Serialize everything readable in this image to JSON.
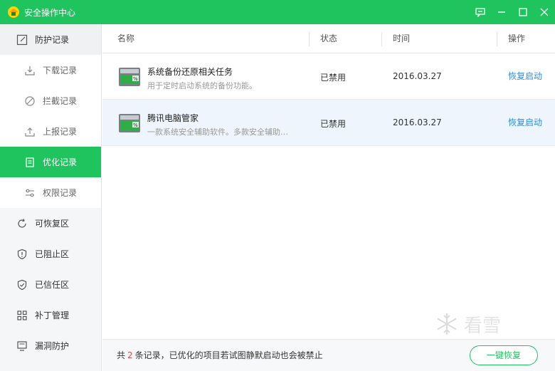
{
  "window": {
    "title": "安全操作中心",
    "accent": "#1fc45f"
  },
  "sidebar": {
    "items": [
      {
        "label": "防护记录",
        "icon": "edit-icon",
        "level": "group"
      },
      {
        "label": "下载记录",
        "icon": "download-icon",
        "level": "sub"
      },
      {
        "label": "拦截记录",
        "icon": "block-icon",
        "level": "sub"
      },
      {
        "label": "上报记录",
        "icon": "upload-icon",
        "level": "sub"
      },
      {
        "label": "优化记录",
        "icon": "clipboard-icon",
        "level": "sub",
        "active": true
      },
      {
        "label": "权限记录",
        "icon": "sliders-icon",
        "level": "sub"
      },
      {
        "label": "可恢复区",
        "icon": "refresh-icon",
        "level": "group"
      },
      {
        "label": "已阻止区",
        "icon": "shield-alert-icon",
        "level": "group"
      },
      {
        "label": "已信任区",
        "icon": "shield-check-icon",
        "level": "group"
      },
      {
        "label": "补丁管理",
        "icon": "grid-icon",
        "level": "group"
      },
      {
        "label": "漏洞防护",
        "icon": "monitor-icon",
        "level": "group"
      }
    ]
  },
  "table": {
    "columns": [
      "名称",
      "状态",
      "时间",
      "操作"
    ],
    "rows": [
      {
        "name": "系统备份还原相关任务",
        "desc": "用于定时启动系统的备份功能。",
        "status": "已禁用",
        "time": "2016.03.27",
        "action": "恢复启动"
      },
      {
        "name": "腾讯电脑管家",
        "desc": "一款系统安全辅助软件。多款安全辅助…",
        "status": "已禁用",
        "time": "2016.03.27",
        "action": "恢复启动"
      }
    ]
  },
  "footer": {
    "prefix": "共",
    "count": "2",
    "suffix": "条记录，已优化的项目若试图静默启动也会被禁止",
    "button": "一键恢复"
  },
  "watermark": {
    "text": "看雪"
  }
}
